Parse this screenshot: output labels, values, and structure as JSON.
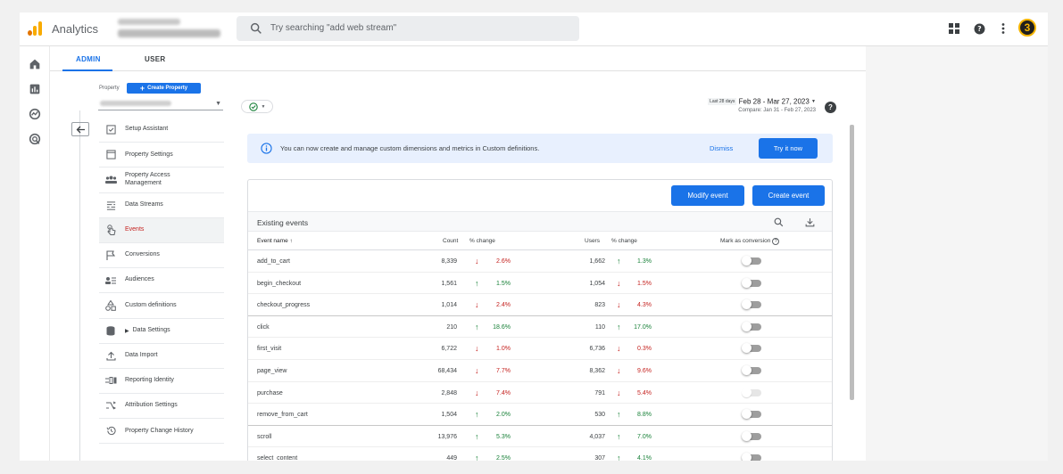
{
  "app": {
    "name": "Analytics"
  },
  "search": {
    "placeholder": "Try searching \"add web stream\""
  },
  "topbar": {
    "account_badge": "3"
  },
  "tabs": [
    {
      "label": "ADMIN",
      "active": true
    },
    {
      "label": "USER",
      "active": false
    }
  ],
  "property": {
    "label": "Property",
    "create_label": "Create Property"
  },
  "nav": {
    "items": [
      {
        "label": "Setup Assistant",
        "icon": "checklist-icon"
      },
      {
        "label": "Property Settings",
        "icon": "window-icon"
      },
      {
        "label": "Property Access Management",
        "icon": "people-icon"
      },
      {
        "label": "Data Streams",
        "icon": "streams-icon"
      },
      {
        "label": "Events",
        "icon": "touch-icon",
        "active": true
      },
      {
        "label": "Conversions",
        "icon": "flag-icon"
      },
      {
        "label": "Audiences",
        "icon": "audience-icon"
      },
      {
        "label": "Custom definitions",
        "icon": "shapes-icon"
      },
      {
        "label": "Data Settings",
        "icon": "database-icon",
        "expandable": true
      },
      {
        "label": "Data Import",
        "icon": "upload-icon"
      },
      {
        "label": "Reporting Identity",
        "icon": "identity-icon"
      },
      {
        "label": "Attribution Settings",
        "icon": "attribution-icon"
      },
      {
        "label": "Property Change History",
        "icon": "history-icon"
      }
    ]
  },
  "date": {
    "period_label": "Last 28 days",
    "range": "Feb 28 - Mar 27, 2023",
    "compare": "Compare: Jan 31 - Feb 27, 2023"
  },
  "banner": {
    "text": "You can now create and manage custom dimensions and metrics in Custom definitions.",
    "dismiss": "Dismiss",
    "try": "Try it now"
  },
  "table": {
    "modify_label": "Modify event",
    "create_label": "Create event",
    "title": "Existing events",
    "headers": {
      "event_name": "Event name",
      "count": "Count",
      "count_change": "% change",
      "users": "Users",
      "users_change": "% change",
      "conversion": "Mark as conversion"
    },
    "rows": [
      {
        "name": "add_to_cart",
        "count": "8,339",
        "count_dir": "down",
        "count_pct": "2.6%",
        "users": "1,662",
        "users_dir": "up",
        "users_pct": "1.3%",
        "toggle_enabled": true
      },
      {
        "name": "begin_checkout",
        "count": "1,561",
        "count_dir": "up",
        "count_pct": "1.5%",
        "users": "1,054",
        "users_dir": "down",
        "users_pct": "1.5%",
        "toggle_enabled": true
      },
      {
        "name": "checkout_progress",
        "count": "1,014",
        "count_dir": "down",
        "count_pct": "2.4%",
        "users": "823",
        "users_dir": "down",
        "users_pct": "4.3%",
        "toggle_enabled": true
      },
      {
        "name": "click",
        "count": "210",
        "count_dir": "up",
        "count_pct": "18.6%",
        "users": "110",
        "users_dir": "up",
        "users_pct": "17.0%",
        "toggle_enabled": true
      },
      {
        "name": "first_visit",
        "count": "6,722",
        "count_dir": "down",
        "count_pct": "1.0%",
        "users": "6,736",
        "users_dir": "down",
        "users_pct": "0.3%",
        "toggle_enabled": true
      },
      {
        "name": "page_view",
        "count": "68,434",
        "count_dir": "down",
        "count_pct": "7.7%",
        "users": "8,362",
        "users_dir": "down",
        "users_pct": "9.6%",
        "toggle_enabled": true
      },
      {
        "name": "purchase",
        "count": "2,848",
        "count_dir": "down",
        "count_pct": "7.4%",
        "users": "791",
        "users_dir": "down",
        "users_pct": "5.4%",
        "toggle_enabled": false
      },
      {
        "name": "remove_from_cart",
        "count": "1,504",
        "count_dir": "up",
        "count_pct": "2.0%",
        "users": "530",
        "users_dir": "up",
        "users_pct": "8.8%",
        "toggle_enabled": true
      },
      {
        "name": "scroll",
        "count": "13,976",
        "count_dir": "up",
        "count_pct": "5.3%",
        "users": "4,037",
        "users_dir": "up",
        "users_pct": "7.0%",
        "toggle_enabled": true
      },
      {
        "name": "select_content",
        "count": "449",
        "count_dir": "up",
        "count_pct": "2.5%",
        "users": "307",
        "users_dir": "up",
        "users_pct": "4.1%",
        "toggle_enabled": true
      }
    ]
  },
  "colors": {
    "primary": "#1a73e8",
    "up": "#188038",
    "down": "#c5221f",
    "logo_orange": "#f9ab00",
    "logo_dark": "#e37400"
  }
}
